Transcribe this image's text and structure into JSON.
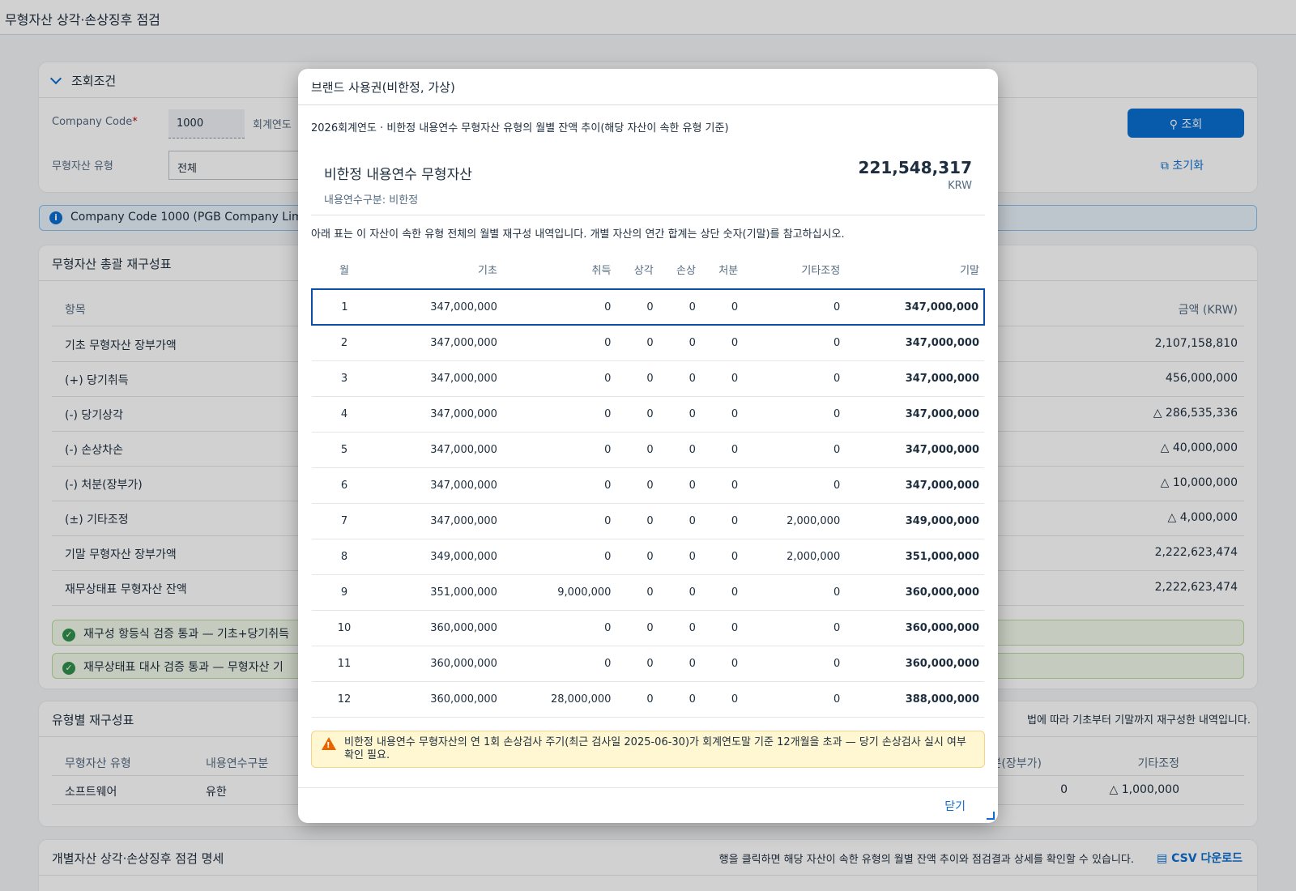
{
  "page": {
    "title": "무형자산 상각·손상징후 점검"
  },
  "filters": {
    "panel_title": "조회조건",
    "company_code_label": "Company Code",
    "company_code_value": "1000",
    "fiscal_year_label": "회계연도",
    "asset_type_label": "무형자산 유형",
    "asset_type_value": "전체",
    "search_button": "조회",
    "reset_button": "초기화"
  },
  "info_strip": "Company Code 1000 (PGB Company Limited",
  "recon": {
    "title": "무형자산 총괄 재구성표",
    "col_item": "항목",
    "col_amount": "금액 (KRW)",
    "rows": [
      {
        "label": "기초 무형자산 장부가액",
        "amount": "2,107,158,810"
      },
      {
        "label": "(+) 당기취득",
        "amount": "456,000,000"
      },
      {
        "label": "(-) 당기상각",
        "amount": "△ 286,535,336"
      },
      {
        "label": "(-) 손상차손",
        "amount": "△ 40,000,000"
      },
      {
        "label": "(-) 처분(장부가)",
        "amount": "△ 10,000,000"
      },
      {
        "label": "(±) 기타조정",
        "amount": "△ 4,000,000"
      },
      {
        "label": "기말 무형자산 장부가액",
        "amount": "2,222,623,474"
      },
      {
        "label": "재무상태표 무형자산 잔액",
        "amount": "2,222,623,474"
      }
    ],
    "check1": "재구성 항등식 검증 통과 — 기초+당기취득",
    "check2": "재무상태표 대사 검증 통과 — 무형자산 기"
  },
  "by_type": {
    "title": "유형별 재구성표",
    "note": "법에 따라 기초부터 기말까지 재구성한 내역입니다.",
    "col1": "무형자산 유형",
    "col2": "내용연수구분",
    "col3": "처분(장부가)",
    "col4": "기타조정",
    "row_type": "소프트웨어",
    "row_life": "유한",
    "row_disposal": "0",
    "row_other": "△ 1,000,000"
  },
  "detail": {
    "title": "개별자산 상각·손상징후 점검 명세",
    "hint": "행을 클릭하면 해당 자산이 속한 유형의 월별 잔액 추이와 점검결과 상세를 확인할 수 있습니다.",
    "csv_button": "CSV 다운로드"
  },
  "dialog": {
    "title": "브랜드 사용권(비한정, 가상)",
    "subtitle": "2026회계연도 · 비한정 내용연수 무형자산 유형의 월별 잔액 추이(해당 자산이 속한 유형 기준)",
    "asset_group": "비한정 내용연수 무형자산",
    "asset_life": "내용연수구분: 비한정",
    "total_amount": "221,548,317",
    "currency": "KRW",
    "note": "아래 표는 이 자산이 속한 유형 전체의 월별 재구성 내역입니다. 개별 자산의 연간 합계는 상단 숫자(기말)를 참고하십시오.",
    "columns": [
      "월",
      "기초",
      "취득",
      "상각",
      "손상",
      "처분",
      "기타조정",
      "기말"
    ],
    "rows": [
      [
        "1",
        "347,000,000",
        "0",
        "0",
        "0",
        "0",
        "0",
        "347,000,000"
      ],
      [
        "2",
        "347,000,000",
        "0",
        "0",
        "0",
        "0",
        "0",
        "347,000,000"
      ],
      [
        "3",
        "347,000,000",
        "0",
        "0",
        "0",
        "0",
        "0",
        "347,000,000"
      ],
      [
        "4",
        "347,000,000",
        "0",
        "0",
        "0",
        "0",
        "0",
        "347,000,000"
      ],
      [
        "5",
        "347,000,000",
        "0",
        "0",
        "0",
        "0",
        "0",
        "347,000,000"
      ],
      [
        "6",
        "347,000,000",
        "0",
        "0",
        "0",
        "0",
        "0",
        "347,000,000"
      ],
      [
        "7",
        "347,000,000",
        "0",
        "0",
        "0",
        "0",
        "2,000,000",
        "349,000,000"
      ],
      [
        "8",
        "349,000,000",
        "0",
        "0",
        "0",
        "0",
        "2,000,000",
        "351,000,000"
      ],
      [
        "9",
        "351,000,000",
        "9,000,000",
        "0",
        "0",
        "0",
        "0",
        "360,000,000"
      ],
      [
        "10",
        "360,000,000",
        "0",
        "0",
        "0",
        "0",
        "0",
        "360,000,000"
      ],
      [
        "11",
        "360,000,000",
        "0",
        "0",
        "0",
        "0",
        "0",
        "360,000,000"
      ],
      [
        "12",
        "360,000,000",
        "28,000,000",
        "0",
        "0",
        "0",
        "0",
        "388,000,000"
      ]
    ],
    "warning": "비한정 내용연수 무형자산의 연 1회 손상검사 주기(최근 검사일 2025-06-30)가 회계연도말 기준 12개월을 초과 — 당기 손상검사 실시 여부 확인 필요.",
    "close_button": "닫기"
  }
}
